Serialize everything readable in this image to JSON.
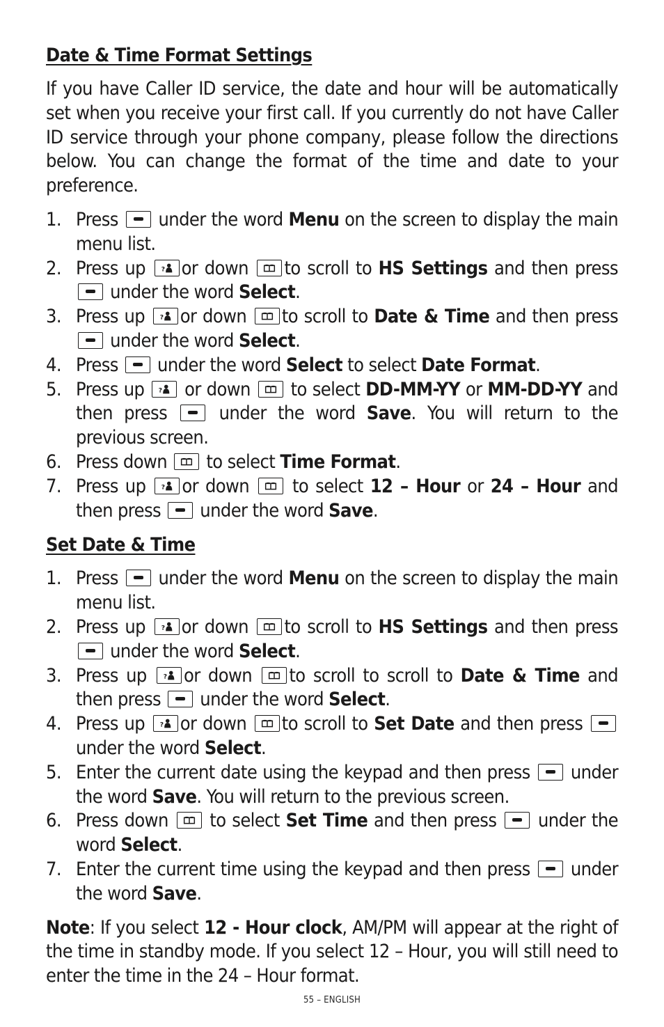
{
  "section1": {
    "title": "Date & Time Format Settings",
    "intro": "If you have Caller ID service, the date and hour will be automatically set when you receive your first call. If you currently do not have Caller ID service through your phone company, please follow the directions below.  You can change the format of the time and date to your preference.",
    "steps": [
      {
        "num": "1.",
        "parts": [
          {
            "t": "Press "
          },
          {
            "icon": "soft"
          },
          {
            "t": " under the word "
          },
          {
            "b": "Menu"
          },
          {
            "t": " on the screen to display the main menu list."
          }
        ]
      },
      {
        "num": "2.",
        "parts": [
          {
            "t": "Press up "
          },
          {
            "icon": "up"
          },
          {
            "t": "or down "
          },
          {
            "icon": "down"
          },
          {
            "t": "to scroll to "
          },
          {
            "b": "HS Settings"
          },
          {
            "t": " and then press "
          },
          {
            "icon": "soft"
          },
          {
            "t": " under the word "
          },
          {
            "b": "Select"
          },
          {
            "t": "."
          }
        ]
      },
      {
        "num": "3.",
        "parts": [
          {
            "t": "Press up "
          },
          {
            "icon": "up"
          },
          {
            "t": "or down "
          },
          {
            "icon": "down"
          },
          {
            "t": "to scroll to "
          },
          {
            "b": "Date & Time"
          },
          {
            "t": " and then press "
          },
          {
            "icon": "soft"
          },
          {
            "t": " under the word "
          },
          {
            "b": "Select"
          },
          {
            "t": "."
          }
        ]
      },
      {
        "num": "4.",
        "parts": [
          {
            "t": "Press "
          },
          {
            "icon": "soft"
          },
          {
            "t": " under the word "
          },
          {
            "b": "Select"
          },
          {
            "t": " to select "
          },
          {
            "b": "Date Format"
          },
          {
            "t": "."
          }
        ]
      },
      {
        "num": "5.",
        "parts": [
          {
            "t": "Press up "
          },
          {
            "icon": "up"
          },
          {
            "t": " or down "
          },
          {
            "icon": "down"
          },
          {
            "t": " to select "
          },
          {
            "b": "DD-MM-YY"
          },
          {
            "t": " or "
          },
          {
            "b": "MM-DD-YY"
          },
          {
            "t": " and then press "
          },
          {
            "icon": "soft"
          },
          {
            "t": " under the word "
          },
          {
            "b": "Save"
          },
          {
            "t": ".  You will return to the previous screen."
          }
        ]
      },
      {
        "num": "6.",
        "parts": [
          {
            "t": "Press down "
          },
          {
            "icon": "down"
          },
          {
            "t": " to select "
          },
          {
            "b": "Time Format"
          },
          {
            "t": "."
          }
        ]
      },
      {
        "num": "7.",
        "parts": [
          {
            "t": "Press up "
          },
          {
            "icon": "up"
          },
          {
            "t": "or down "
          },
          {
            "icon": "down"
          },
          {
            "t": " to select "
          },
          {
            "b": "12 – Hour"
          },
          {
            "t": " or "
          },
          {
            "b": "24 – Hour"
          },
          {
            "t": " and then press "
          },
          {
            "icon": "soft"
          },
          {
            "t": " under the word "
          },
          {
            "b": "Save"
          },
          {
            "t": "."
          }
        ]
      }
    ]
  },
  "section2": {
    "title": "Set Date & Time ",
    "steps": [
      {
        "num": "1.",
        "parts": [
          {
            "t": "Press "
          },
          {
            "icon": "soft"
          },
          {
            "t": " under the word "
          },
          {
            "b": "Menu"
          },
          {
            "t": " on the screen to display the main menu list."
          }
        ]
      },
      {
        "num": "2.",
        "parts": [
          {
            "t": "Press up "
          },
          {
            "icon": "up"
          },
          {
            "t": "or down "
          },
          {
            "icon": "down"
          },
          {
            "t": "to scroll to "
          },
          {
            "b": "HS Settings"
          },
          {
            "t": " and then press "
          },
          {
            "icon": "soft"
          },
          {
            "t": " under the word "
          },
          {
            "b": "Select"
          },
          {
            "t": "."
          }
        ]
      },
      {
        "num": "3.",
        "parts": [
          {
            "t": "Press up "
          },
          {
            "icon": "up"
          },
          {
            "t": "or down "
          },
          {
            "icon": "down"
          },
          {
            "t": "to scroll to scroll to "
          },
          {
            "b": "Date & Time"
          },
          {
            "t": " and then press "
          },
          {
            "icon": "soft"
          },
          {
            "t": " under the word "
          },
          {
            "b": "Select"
          },
          {
            "t": "."
          }
        ]
      },
      {
        "num": "4.",
        "parts": [
          {
            "t": "Press up "
          },
          {
            "icon": "up"
          },
          {
            "t": "or down "
          },
          {
            "icon": "down"
          },
          {
            "t": "to scroll to "
          },
          {
            "b": "Set Date"
          },
          {
            "t": " and then press "
          },
          {
            "icon": "soft"
          },
          {
            "t": "under the word "
          },
          {
            "b": "Select"
          },
          {
            "t": "."
          }
        ]
      },
      {
        "num": "5.",
        "parts": [
          {
            "t": "Enter the current date using the keypad and then press "
          },
          {
            "icon": "soft"
          },
          {
            "t": " under the word "
          },
          {
            "b": "Save"
          },
          {
            "t": ". You will return to the previous screen."
          }
        ]
      },
      {
        "num": "6.",
        "parts": [
          {
            "t": "Press down "
          },
          {
            "icon": "down"
          },
          {
            "t": " to select "
          },
          {
            "b": "Set Time"
          },
          {
            "t": " and then press "
          },
          {
            "icon": "soft"
          },
          {
            "t": " under the word "
          },
          {
            "b": "Select"
          },
          {
            "t": "."
          }
        ]
      },
      {
        "num": "7.",
        "parts": [
          {
            "t": "Enter the current time using the keypad and then press "
          },
          {
            "icon": "soft"
          },
          {
            "t": " under the word "
          },
          {
            "b": "Save"
          },
          {
            "t": "."
          }
        ]
      }
    ]
  },
  "note": {
    "parts": [
      {
        "b": "Note"
      },
      {
        "t": ": If you select "
      },
      {
        "b": "12 - Hour clock"
      },
      {
        "t": ", AM/PM will appear at the right of the time in standby mode.  If you select 12 – Hour, you will still need to enter the time in the 24 – Hour format."
      }
    ]
  },
  "icons": {
    "soft": "softkey-icon",
    "up": "phonebook-caller-id-up-icon",
    "down": "directory-book-down-icon"
  },
  "footer": {
    "page_label": "55 – ENGLISH"
  }
}
